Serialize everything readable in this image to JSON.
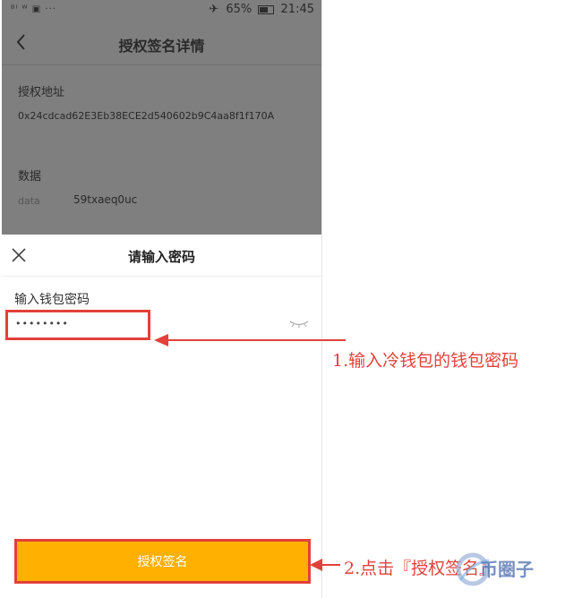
{
  "status_bar": {
    "left_icons": "ᴮᴵ ᵂ ▣ ···",
    "battery": "65%",
    "time": "21:45"
  },
  "header": {
    "title": "授权签名详情"
  },
  "details": {
    "address_label": "授权地址",
    "address_value": "0x24cdcad62E3Eb38ECE2d540602b9C4aa8f1f170A",
    "data_label": "数据",
    "data_key": "data",
    "data_value": "59txaeq0uc"
  },
  "password_sheet": {
    "title": "请输入密码",
    "field_label": "输入钱包密码",
    "field_value": "••••••••",
    "submit_label": "授权签名"
  },
  "annotations": {
    "step1": "1.输入冷钱包的钱包密码",
    "step2": "2.点击『授权签名』"
  },
  "watermark": "币圈子",
  "colors": {
    "accent_orange": "#ffb000",
    "annotation_red": "#e2413a",
    "overlay_gray": "#7f7f7f"
  }
}
